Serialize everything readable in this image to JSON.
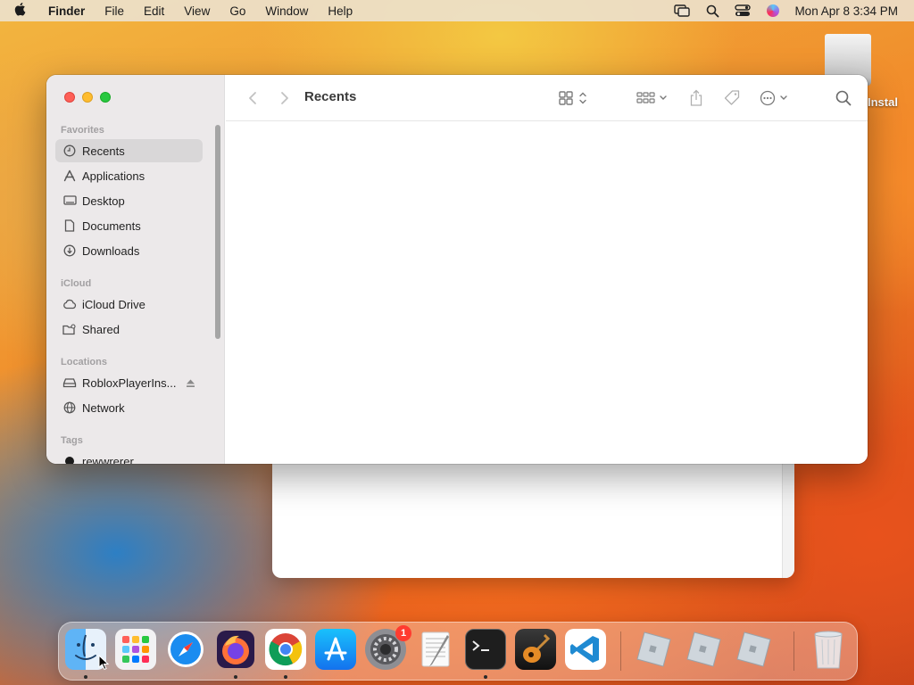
{
  "menubar": {
    "app_name": "Finder",
    "items": [
      "File",
      "Edit",
      "View",
      "Go",
      "Window",
      "Help"
    ],
    "clock": "Mon Apr 8  3:34 PM"
  },
  "desktop": {
    "disk_label": "Instal"
  },
  "finder": {
    "title": "Recents",
    "sidebar": {
      "favorites_header": "Favorites",
      "favorites": [
        {
          "label": "Recents",
          "icon": "clock-icon",
          "selected": true
        },
        {
          "label": "Applications",
          "icon": "applications-icon"
        },
        {
          "label": "Desktop",
          "icon": "desktop-icon"
        },
        {
          "label": "Documents",
          "icon": "document-icon"
        },
        {
          "label": "Downloads",
          "icon": "download-icon"
        }
      ],
      "icloud_header": "iCloud",
      "icloud": [
        {
          "label": "iCloud Drive",
          "icon": "cloud-icon"
        },
        {
          "label": "Shared",
          "icon": "shared-folder-icon"
        }
      ],
      "locations_header": "Locations",
      "locations": [
        {
          "label": "RobloxPlayerIns...",
          "icon": "disk-icon"
        },
        {
          "label": "Network",
          "icon": "globe-icon"
        }
      ],
      "tags_header": "Tags",
      "tags": [
        {
          "label": "rewwrerer",
          "color": "#1b1b1b"
        }
      ]
    }
  },
  "dock": {
    "items": [
      {
        "name": "Finder",
        "running": true
      },
      {
        "name": "Launchpad",
        "running": false
      },
      {
        "name": "Safari",
        "running": false
      },
      {
        "name": "Firefox",
        "running": true
      },
      {
        "name": "Chrome",
        "running": true
      },
      {
        "name": "App Store",
        "running": false
      },
      {
        "name": "System Settings",
        "running": false,
        "badge": "1"
      },
      {
        "name": "TextEdit",
        "running": false
      },
      {
        "name": "Terminal",
        "running": true
      },
      {
        "name": "GarageBand",
        "running": false
      },
      {
        "name": "Visual Studio Code",
        "running": false
      },
      {
        "name": "Roblox",
        "running": false
      },
      {
        "name": "Roblox",
        "running": false
      },
      {
        "name": "Roblox",
        "running": false
      },
      {
        "name": "Trash",
        "running": false
      }
    ]
  }
}
